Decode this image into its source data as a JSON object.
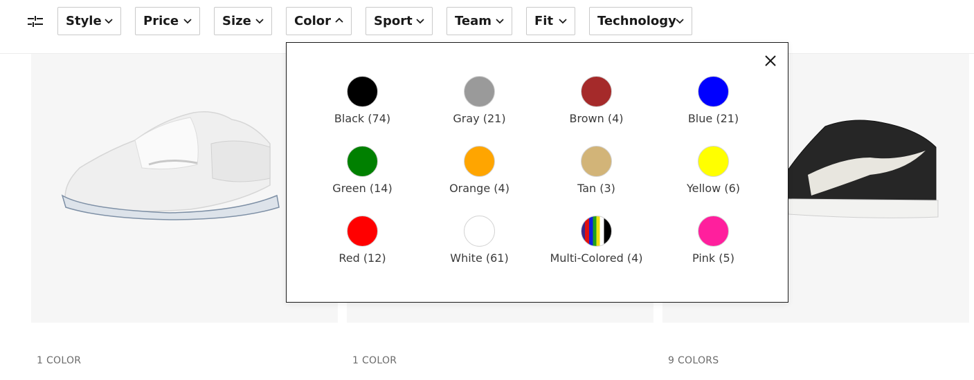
{
  "filters": [
    {
      "label": "Style",
      "open": false
    },
    {
      "label": "Price",
      "open": false
    },
    {
      "label": "Size",
      "open": false
    },
    {
      "label": "Color",
      "open": true
    },
    {
      "label": "Sport",
      "open": false
    },
    {
      "label": "Team",
      "open": false
    },
    {
      "label": "Fit",
      "open": false
    },
    {
      "label": "Technology",
      "open": false
    }
  ],
  "color_dropdown": {
    "options": [
      {
        "label": "Black (74)",
        "color": "#000000"
      },
      {
        "label": "Gray (21)",
        "color": "#9a9a9a"
      },
      {
        "label": "Brown (4)",
        "color": "#a52a2a"
      },
      {
        "label": "Blue (21)",
        "color": "#0000ff"
      },
      {
        "label": "Green (14)",
        "color": "#008000"
      },
      {
        "label": "Orange (4)",
        "color": "#ffa500"
      },
      {
        "label": "Tan (3)",
        "color": "#d2b478"
      },
      {
        "label": "Yellow (6)",
        "color": "#ffff00"
      },
      {
        "label": "Red (12)",
        "color": "#ff0000"
      },
      {
        "label": "White (61)",
        "color": "#ffffff"
      },
      {
        "label": "Multi-Colored (4)",
        "color": "multi"
      },
      {
        "label": "Pink (5)",
        "color": "#ff1f9d"
      }
    ]
  },
  "products": [
    {
      "colors_label": "1 COLOR"
    },
    {
      "colors_label": "1 COLOR"
    },
    {
      "colors_label": "9 COLORS"
    }
  ]
}
